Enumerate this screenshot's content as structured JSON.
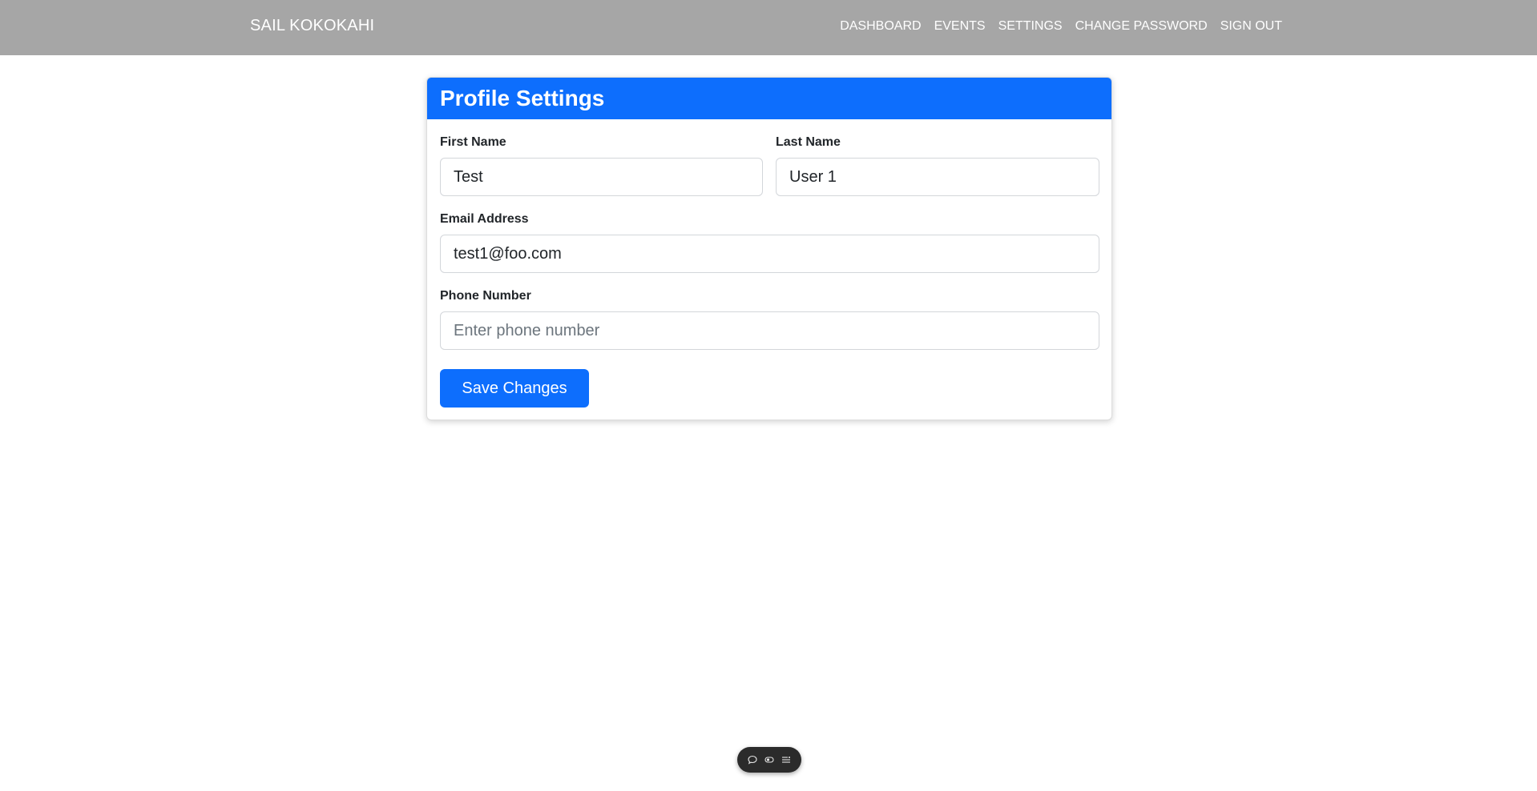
{
  "navbar": {
    "brand": "SAIL KOKOKAHI",
    "links": [
      "DASHBOARD",
      "EVENTS",
      "SETTINGS",
      "CHANGE PASSWORD",
      "SIGN OUT"
    ]
  },
  "card": {
    "title": "Profile Settings",
    "first_name": {
      "label": "First Name",
      "value": "Test"
    },
    "last_name": {
      "label": "Last Name",
      "value": "User 1"
    },
    "email": {
      "label": "Email Address",
      "value": "test1@foo.com"
    },
    "phone": {
      "label": "Phone Number",
      "value": "",
      "placeholder": "Enter phone number"
    },
    "save_label": "Save Changes"
  },
  "toolbar": {
    "icons": [
      "chat-icon",
      "toggle-icon",
      "menu-icon"
    ]
  },
  "colors": {
    "navbar_bg": "#a6a6a6",
    "primary": "#0d6efd"
  }
}
